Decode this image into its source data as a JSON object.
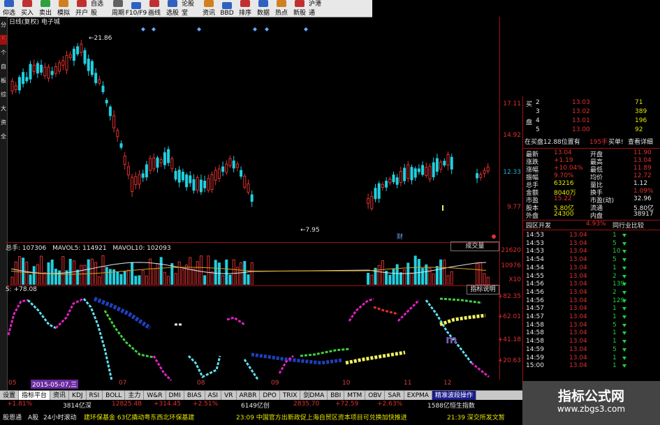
{
  "toolbar": [
    {
      "label": "仰选",
      "color": "#3060c0"
    },
    {
      "label": "买入",
      "color": "#c03030"
    },
    {
      "label": "卖出",
      "color": "#30a040"
    },
    {
      "label": "模拟",
      "color": "#d08020"
    },
    {
      "label": "开户",
      "color": "#c03030"
    },
    {
      "label": "自选股",
      "color": "#3060c0"
    },
    {
      "label": "周期",
      "color": "#606060"
    },
    {
      "label": "F10/F9",
      "color": "#3060c0"
    },
    {
      "label": "画线",
      "color": "#c03030"
    },
    {
      "label": "选股",
      "color": "#3060c0"
    },
    {
      "label": "论股堂",
      "color": "#30a040"
    },
    {
      "label": "资讯",
      "color": "#d08020"
    },
    {
      "label": "BBD",
      "color": "#3060c0"
    },
    {
      "label": "排序",
      "color": "#c03030"
    },
    {
      "label": "数据",
      "color": "#3060c0"
    },
    {
      "label": "热点",
      "color": "#d08020"
    },
    {
      "label": "新股",
      "color": "#c03030"
    },
    {
      "label": "沪港通",
      "color": "#3060c0"
    }
  ],
  "left_strip": [
    "分时",
    "K线",
    "个股",
    "自选",
    "板块",
    "综合",
    "大盘",
    "资讯",
    "全景"
  ],
  "chart_title": "日线(复权) 电子城",
  "annotations": {
    "high": "21.86",
    "low": "7.95",
    "cai": "财"
  },
  "axis_main": [
    {
      "v": "17.11",
      "c": "red"
    },
    {
      "v": "14.92",
      "c": "red"
    },
    {
      "v": "12.33",
      "c": "cyn"
    },
    {
      "v": "9.77",
      "c": "red"
    }
  ],
  "volume": {
    "label_total": "总手: 107306",
    "label_ma5": "MAVOL5: 114921",
    "label_ma10": "MAVOL10: 102093",
    "tag": "成交量",
    "axis": [
      "21620",
      "10976",
      "X10"
    ]
  },
  "indicator": {
    "label": "S: +78.08",
    "tag": "指标说明",
    "axis": [
      "+82.35",
      "+62.01",
      "+41.18",
      "+20.63"
    ]
  },
  "dates": [
    {
      "t": "05"
    },
    {
      "t": "2015-05-07,三",
      "hl": true
    },
    {
      "t": "07"
    },
    {
      "t": "08"
    },
    {
      "t": "09"
    },
    {
      "t": "10"
    },
    {
      "t": "11"
    },
    {
      "t": "12"
    }
  ],
  "tabs": [
    {
      "t": "设置"
    },
    {
      "t": "指标平台",
      "a": true
    },
    {
      "t": "资讯"
    },
    {
      "t": "KDJ"
    },
    {
      "t": "RSI"
    },
    {
      "t": "BOLL"
    },
    {
      "t": "主力"
    },
    {
      "t": "W&R"
    },
    {
      "t": "DMI"
    },
    {
      "t": "BIAS"
    },
    {
      "t": "ASI"
    },
    {
      "t": "VR"
    },
    {
      "t": "ARBR"
    },
    {
      "t": "DPO"
    },
    {
      "t": "TRIX"
    },
    {
      "t": "剑DMA"
    },
    {
      "t": "BBI"
    },
    {
      "t": "MTM"
    },
    {
      "t": "OBV"
    },
    {
      "t": "SAR"
    },
    {
      "t": "EXPMA"
    },
    {
      "t": "精准波段操作",
      "h": true
    }
  ],
  "status_line": [
    {
      "t": "+1.81%",
      "c": "red"
    },
    {
      "t": "3814亿深",
      "c": "wht"
    },
    {
      "t": "12825.48",
      "c": "red"
    },
    {
      "t": "+314.45",
      "c": "red"
    },
    {
      "t": "+2.51%",
      "c": "red"
    },
    {
      "t": "6149亿创",
      "c": "wht"
    },
    {
      "t": "2835.70",
      "c": "red"
    },
    {
      "t": "+72.59",
      "c": "red"
    },
    {
      "t": "+2.63%",
      "c": "red"
    },
    {
      "t": "1588亿恒生指数",
      "c": "wht"
    }
  ],
  "ticker": [
    {
      "t": "股恩通",
      "c": "wht"
    },
    {
      "t": "A股",
      "c": "wht"
    },
    {
      "t": "24小时滚动",
      "c": "wht"
    },
    {
      "t": "建环保基金 63亿撬动粤东西北环保基建",
      "c": "yel"
    },
    {
      "t": "23:09 中国官方出新政促上海自贸区资本项目可兑换加快推进",
      "c": "yel"
    },
    {
      "t": "21:39 深交所发文暂",
      "c": "yel"
    }
  ],
  "orderbook": [
    {
      "side": "买",
      "n": "2",
      "p": "13.03",
      "v": "71"
    },
    {
      "side": "",
      "n": "3",
      "p": "13.02",
      "v": "389"
    },
    {
      "side": "盘",
      "n": "4",
      "p": "13.01",
      "v": "196"
    },
    {
      "side": "",
      "n": "5",
      "p": "13.00",
      "v": "92"
    }
  ],
  "ob_info": {
    "left": "在买盘12.88位置有",
    "mid": "195手",
    "btn1": "买单!",
    "btn2": "查看详细"
  },
  "quote": [
    {
      "l": "最新",
      "v": "13.04",
      "l2": "开盘",
      "v2": "11.90"
    },
    {
      "l": "涨跌",
      "v": "+1.19",
      "l2": "最高",
      "v2": "13.04"
    },
    {
      "l": "涨幅",
      "v": "+10.04%",
      "l2": "最低",
      "v2": "11.89"
    },
    {
      "l": "振幅",
      "v": "9.70%",
      "l2": "均价",
      "v2": "12.72"
    },
    {
      "l": "总手",
      "v": "63216",
      "l2": "量比",
      "v2": "1.12"
    },
    {
      "l": "金额",
      "v": "8040万",
      "l2": "换手",
      "v2": "1.09%"
    },
    {
      "l": "市盈",
      "v": "15.22",
      "l2": "市盈(动)",
      "v2": "32.96"
    },
    {
      "l": "股本",
      "v": "5.80亿",
      "l2": "流通",
      "v2": "5.80亿"
    },
    {
      "l": "外盘",
      "v": "24300",
      "l2": "内盘",
      "v2": "38917"
    }
  ],
  "sector": {
    "name": "园区开发",
    "pct": "4.93%",
    "btn": "同行业比较"
  },
  "trades": [
    {
      "t": "14:53",
      "p": "13.04",
      "v": "1"
    },
    {
      "t": "14:53",
      "p": "13.04",
      "v": "5"
    },
    {
      "t": "14:53",
      "p": "13.04",
      "v": "10"
    },
    {
      "t": "14:54",
      "p": "13.04",
      "v": "5"
    },
    {
      "t": "14:54",
      "p": "13.04",
      "v": "1"
    },
    {
      "t": "14:55",
      "p": "13.04",
      "v": "2"
    },
    {
      "t": "14:56",
      "p": "13.04",
      "v": "139"
    },
    {
      "t": "14:56",
      "p": "13.04",
      "v": "2"
    },
    {
      "t": "14:56",
      "p": "13.04",
      "v": "129"
    },
    {
      "t": "14:57",
      "p": "13.04",
      "v": "1"
    },
    {
      "t": "14:57",
      "p": "13.04",
      "v": "1"
    },
    {
      "t": "14:58",
      "p": "13.04",
      "v": "5"
    },
    {
      "t": "14:58",
      "p": "13.04",
      "v": "1"
    },
    {
      "t": "14:58",
      "p": "13.04",
      "v": "1"
    },
    {
      "t": "14:59",
      "p": "13.04",
      "v": "5"
    },
    {
      "t": "14:59",
      "p": "13.04",
      "v": "1"
    },
    {
      "t": "15:00",
      "p": "13.04",
      "v": "1"
    }
  ],
  "watermark": {
    "title": "指标公式网",
    "url": "www.zbgs3.com"
  },
  "colors": {
    "up": "#e03030",
    "down": "#20d0e0",
    "ma": "#e6e6e6",
    "ind_mag": "#e020c0",
    "ind_cyan": "#60e0f0",
    "ind_blue": "#2040c0",
    "ind_green": "#40d040",
    "ind_red": "#e03030",
    "ind_yellow": "#f0f060",
    "ind_white": "#e6e6e6"
  }
}
